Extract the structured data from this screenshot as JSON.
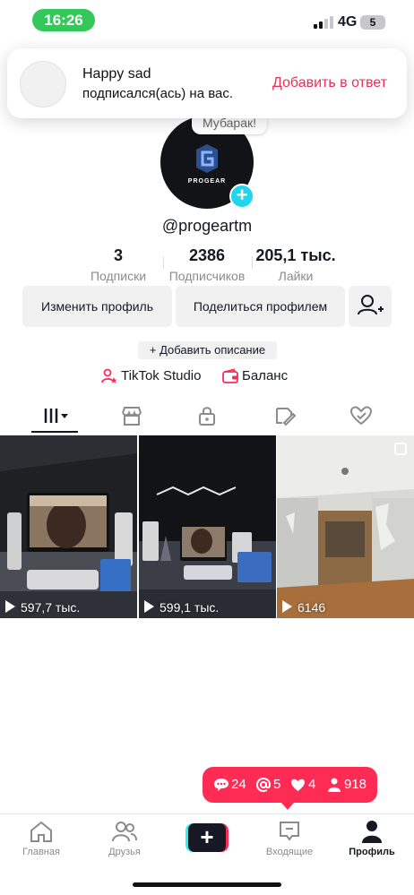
{
  "status": {
    "time": "16:26",
    "network": "4G",
    "battery": "5"
  },
  "notification": {
    "name": "Happy sad",
    "text": "подписался(ась) на вас.",
    "action": "Добавить в ответ"
  },
  "profile": {
    "bubble": "Мубарак!",
    "avatar_caption": "PROGEAR",
    "username": "@progeartm",
    "stats": [
      {
        "value": "3",
        "label": "Подписки"
      },
      {
        "value": "2386",
        "label": "Подписчиков"
      },
      {
        "value": "205,1 тыс.",
        "label": "Лайки"
      }
    ],
    "edit_label": "Изменить профиль",
    "share_label": "Поделиться профилем",
    "add_description": "+ Добавить описание",
    "studio_label": "TikTok Studio",
    "balance_label": "Баланс"
  },
  "tabs": [
    {
      "icon": "grid-icon",
      "active": true
    },
    {
      "icon": "shop-icon"
    },
    {
      "icon": "lock-icon"
    },
    {
      "icon": "repost-icon"
    },
    {
      "icon": "liked-icon"
    }
  ],
  "videos": [
    {
      "views": "597,7 тыс."
    },
    {
      "views": "599,1 тыс."
    },
    {
      "views": "6146",
      "multi": true
    }
  ],
  "activity": {
    "comments": "24",
    "mentions": "5",
    "likes": "4",
    "followers": "918"
  },
  "nav": {
    "home": "Главная",
    "friends": "Друзья",
    "inbox": "Входящие",
    "profile": "Профиль"
  },
  "colors": {
    "accent": "#fe2c55",
    "action": "#e8315a",
    "badge": "#20d5ec",
    "status_pill": "#34c759"
  }
}
